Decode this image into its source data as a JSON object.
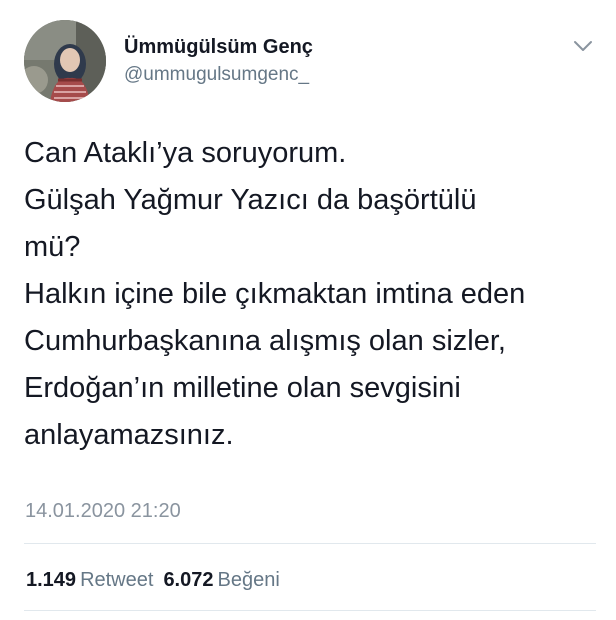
{
  "tweet": {
    "author_name": "Ümmügülsüm Genç",
    "author_handle": "@ummugulsumgenc_",
    "avatar_icon": "profile-photo",
    "menu_icon": "chevron-down-icon",
    "text_lines": [
      "Can Ataklı’ya soruyorum.",
      "Gülşah Yağmur Yazıcı da başörtülü",
      "mü?",
      "Halkın içine bile çıkmaktan imtina eden",
      "Cumhurbaşkanına alışmış olan sizler,",
      "Erdoğan’ın milletine olan sevgisini",
      "anlayamazsınız."
    ],
    "timestamp": "14.01.2020 21:20",
    "stats": {
      "retweets_count": "1.149",
      "retweets_label": "Retweet",
      "likes_count": "6.072",
      "likes_label": "Beğeni"
    }
  },
  "colors": {
    "text": "#141823",
    "secondary": "#657786",
    "divider": "#e1e8ed"
  }
}
